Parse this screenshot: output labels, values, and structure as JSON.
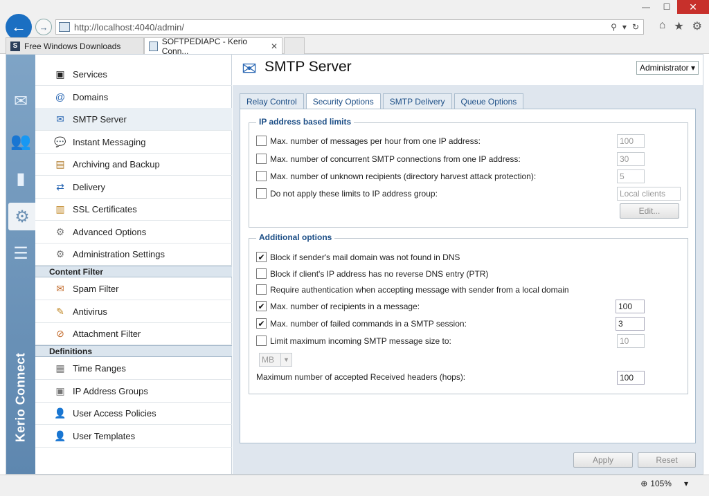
{
  "browser": {
    "url_host": "http://localhost",
    "url_rest": ":4040/admin/",
    "tabs": [
      {
        "label": "Free Windows Downloads",
        "fav": "S"
      },
      {
        "label": "SOFTPEDIAPC - Kerio Conn...",
        "fav": ""
      }
    ],
    "tab_close": "✕",
    "zoom": "105%"
  },
  "rail": {
    "brand": "Kerio Connect"
  },
  "nav": {
    "items": [
      {
        "label": "Services",
        "icon": "services-icon"
      },
      {
        "label": "Domains",
        "icon": "at-icon"
      },
      {
        "label": "SMTP Server",
        "icon": "smtp-icon"
      },
      {
        "label": "Instant Messaging",
        "icon": "chat-icon"
      },
      {
        "label": "Archiving and Backup",
        "icon": "archive-icon"
      },
      {
        "label": "Delivery",
        "icon": "delivery-icon"
      },
      {
        "label": "SSL Certificates",
        "icon": "certificate-icon"
      },
      {
        "label": "Advanced Options",
        "icon": "gears-icon"
      },
      {
        "label": "Administration Settings",
        "icon": "admin-icon"
      }
    ],
    "content_filter_header": "Content Filter",
    "content_filter": [
      {
        "label": "Spam Filter",
        "icon": "spam-icon"
      },
      {
        "label": "Antivirus",
        "icon": "antivirus-icon"
      },
      {
        "label": "Attachment Filter",
        "icon": "attachment-icon"
      }
    ],
    "definitions_header": "Definitions",
    "definitions": [
      {
        "label": "Time Ranges",
        "icon": "calendar-icon"
      },
      {
        "label": "IP Address Groups",
        "icon": "ip-group-icon"
      },
      {
        "label": "User Access Policies",
        "icon": "policy-icon"
      },
      {
        "label": "User Templates",
        "icon": "template-icon"
      }
    ]
  },
  "main": {
    "title": "SMTP Server",
    "admin": "Administrator",
    "tabs": [
      "Relay Control",
      "Security Options",
      "SMTP Delivery",
      "Queue Options"
    ],
    "ip_limits": {
      "title": "IP address based limits",
      "rows": [
        {
          "label": "Max. number of messages per hour from one IP address:",
          "checked": false,
          "value": "100"
        },
        {
          "label": "Max. number of concurrent SMTP connections from one IP address:",
          "checked": false,
          "value": "30"
        },
        {
          "label": "Max. number of unknown recipients (directory harvest attack protection):",
          "checked": false,
          "value": "5"
        },
        {
          "label": "Do not apply these limits to IP address group:",
          "checked": false,
          "value": "Local clients"
        }
      ],
      "edit_label": "Edit..."
    },
    "additional": {
      "title": "Additional options",
      "rows": [
        {
          "label": "Block if sender's mail domain was not found in DNS",
          "checked": true
        },
        {
          "label": "Block if client's IP address has no reverse DNS entry (PTR)",
          "checked": false
        },
        {
          "label": "Require authentication when accepting message with sender from a local domain",
          "checked": false
        },
        {
          "label": "Max. number of recipients in a message:",
          "checked": true,
          "value": "100"
        },
        {
          "label": "Max. number of failed commands in a SMTP session:",
          "checked": true,
          "value": "3"
        },
        {
          "label": "Limit maximum incoming SMTP message size to:",
          "checked": false,
          "value": "10"
        }
      ],
      "unit": "MB",
      "hops_label": "Maximum number of accepted Received headers (hops):",
      "hops_value": "100"
    },
    "apply_label": "Apply",
    "reset_label": "Reset"
  }
}
